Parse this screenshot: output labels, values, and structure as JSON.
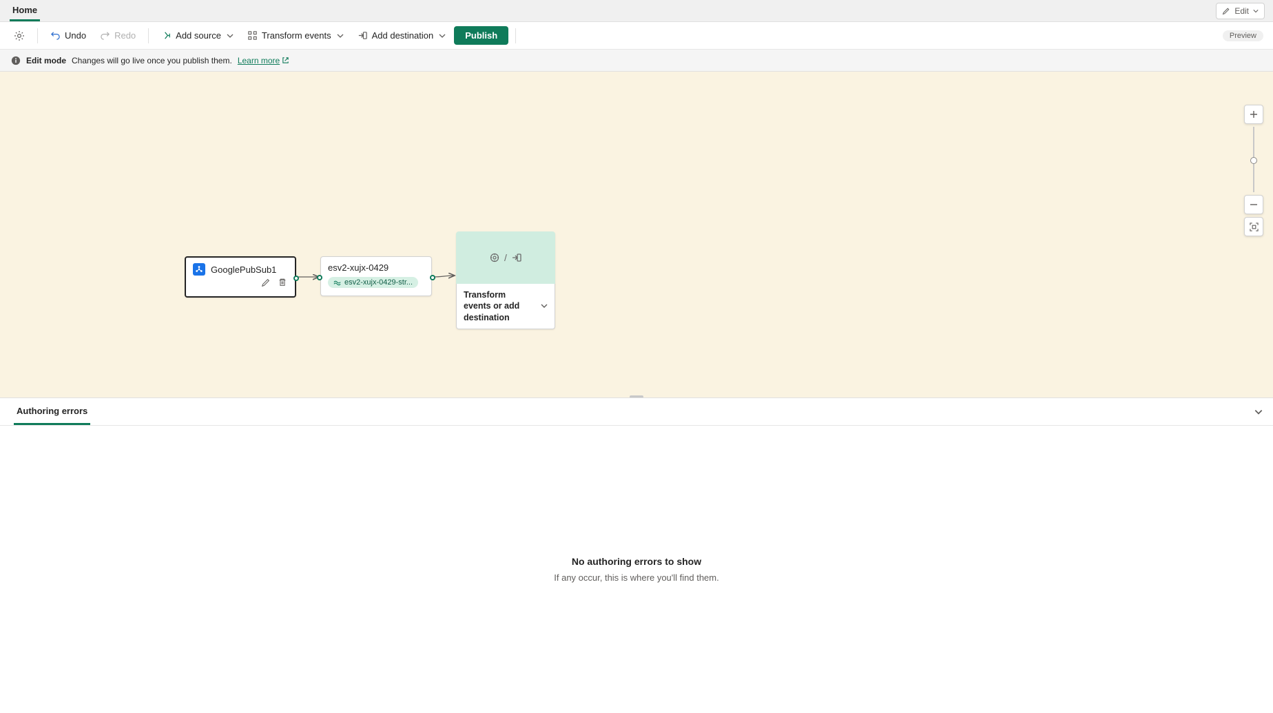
{
  "tabbar": {
    "home": "Home",
    "edit": "Edit"
  },
  "toolbar": {
    "undo": "Undo",
    "redo": "Redo",
    "add_source": "Add source",
    "transform_events": "Transform events",
    "add_destination": "Add destination",
    "publish": "Publish",
    "preview": "Preview"
  },
  "banner": {
    "mode": "Edit mode",
    "msg": "Changes will go live once you publish them.",
    "learn": "Learn more"
  },
  "nodes": {
    "source": {
      "label": "GooglePubSub1"
    },
    "mid": {
      "title": "esv2-xujx-0429",
      "chip": "esv2-xujx-0429-str..."
    },
    "placeholder": {
      "label": "Transform events or add destination"
    }
  },
  "panel": {
    "tab": "Authoring errors",
    "empty_title": "No authoring errors to show",
    "empty_sub": "If any occur, this is where you'll find them."
  }
}
